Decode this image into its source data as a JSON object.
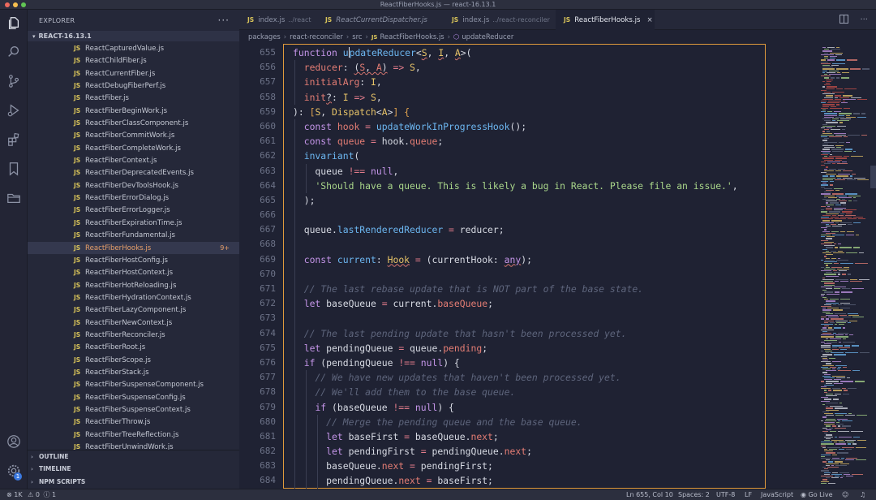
{
  "window": {
    "title": "ReactFiberHooks.js — react-16.13.1"
  },
  "colors": {
    "accent_orange": "#e09a3c",
    "js_icon": "#d9c45a",
    "keyword": "#c495e8",
    "function": "#6cb6f0",
    "type": "#e8c468",
    "string": "#a9d68a",
    "comment": "#5e657c"
  },
  "activity_bar": [
    "files-icon",
    "search-icon",
    "source-control-icon",
    "run-debug-icon",
    "extensions-icon",
    "bookmark-icon",
    "folder-icon",
    "account-icon",
    "settings-icon"
  ],
  "activity_badge": "1",
  "sidebar": {
    "header": "EXPLORER",
    "more": "···",
    "project": "REACT-16.13.1",
    "file_icon": "JS",
    "files": [
      {
        "name": "ReactCapturedValue.js"
      },
      {
        "name": "ReactChildFiber.js"
      },
      {
        "name": "ReactCurrentFiber.js"
      },
      {
        "name": "ReactDebugFiberPerf.js"
      },
      {
        "name": "ReactFiber.js"
      },
      {
        "name": "ReactFiberBeginWork.js"
      },
      {
        "name": "ReactFiberClassComponent.js"
      },
      {
        "name": "ReactFiberCommitWork.js"
      },
      {
        "name": "ReactFiberCompleteWork.js"
      },
      {
        "name": "ReactFiberContext.js"
      },
      {
        "name": "ReactFiberDeprecatedEvents.js"
      },
      {
        "name": "ReactFiberDevToolsHook.js"
      },
      {
        "name": "ReactFiberErrorDialog.js"
      },
      {
        "name": "ReactFiberErrorLogger.js"
      },
      {
        "name": "ReactFiberExpirationTime.js"
      },
      {
        "name": "ReactFiberFundamental.js"
      },
      {
        "name": "ReactFiberHooks.js",
        "badge": "9+",
        "active": true
      },
      {
        "name": "ReactFiberHostConfig.js"
      },
      {
        "name": "ReactFiberHostContext.js"
      },
      {
        "name": "ReactFiberHotReloading.js"
      },
      {
        "name": "ReactFiberHydrationContext.js"
      },
      {
        "name": "ReactFiberLazyComponent.js"
      },
      {
        "name": "ReactFiberNewContext.js"
      },
      {
        "name": "ReactFiberReconciler.js"
      },
      {
        "name": "ReactFiberRoot.js"
      },
      {
        "name": "ReactFiberScope.js"
      },
      {
        "name": "ReactFiberStack.js"
      },
      {
        "name": "ReactFiberSuspenseComponent.js"
      },
      {
        "name": "ReactFiberSuspenseConfig.js"
      },
      {
        "name": "ReactFiberSuspenseContext.js"
      },
      {
        "name": "ReactFiberThrow.js"
      },
      {
        "name": "ReactFiberTreeReflection.js"
      },
      {
        "name": "ReactFiberUnwindWork.js"
      }
    ],
    "sections": [
      "OUTLINE",
      "TIMELINE",
      "NPM SCRIPTS"
    ]
  },
  "tabs": [
    {
      "icon": "JS",
      "label": "index.js",
      "desc": "../react"
    },
    {
      "icon": "JS",
      "label": "ReactCurrentDispatcher.js",
      "desc": ""
    },
    {
      "icon": "JS",
      "label": "index.js",
      "desc": "../react-reconciler"
    },
    {
      "icon": "JS",
      "label": "ReactFiberHooks.js",
      "desc": "",
      "active": true,
      "close": "×"
    }
  ],
  "breadcrumb": [
    "packages",
    "react-reconciler",
    "src",
    "ReactFiberHooks.js",
    "updateReducer"
  ],
  "breadcrumb_icon": "JS",
  "line_numbers": [
    "655",
    "656",
    "657",
    "658",
    "659",
    "660",
    "661",
    "662",
    "663",
    "664",
    "665",
    "666",
    "667",
    "668",
    "669",
    "670",
    "671",
    "672",
    "673",
    "674",
    "675",
    "676",
    "677",
    "678",
    "679",
    "680",
    "681",
    "682",
    "683",
    "684"
  ],
  "status": {
    "errors": "1K",
    "warnings": "0",
    "info": "1",
    "position": "Ln 655, Col 10",
    "spaces": "Spaces: 2",
    "encoding": "UTF-8",
    "eol": "LF",
    "language": "JavaScript",
    "golive": "Go Live"
  }
}
